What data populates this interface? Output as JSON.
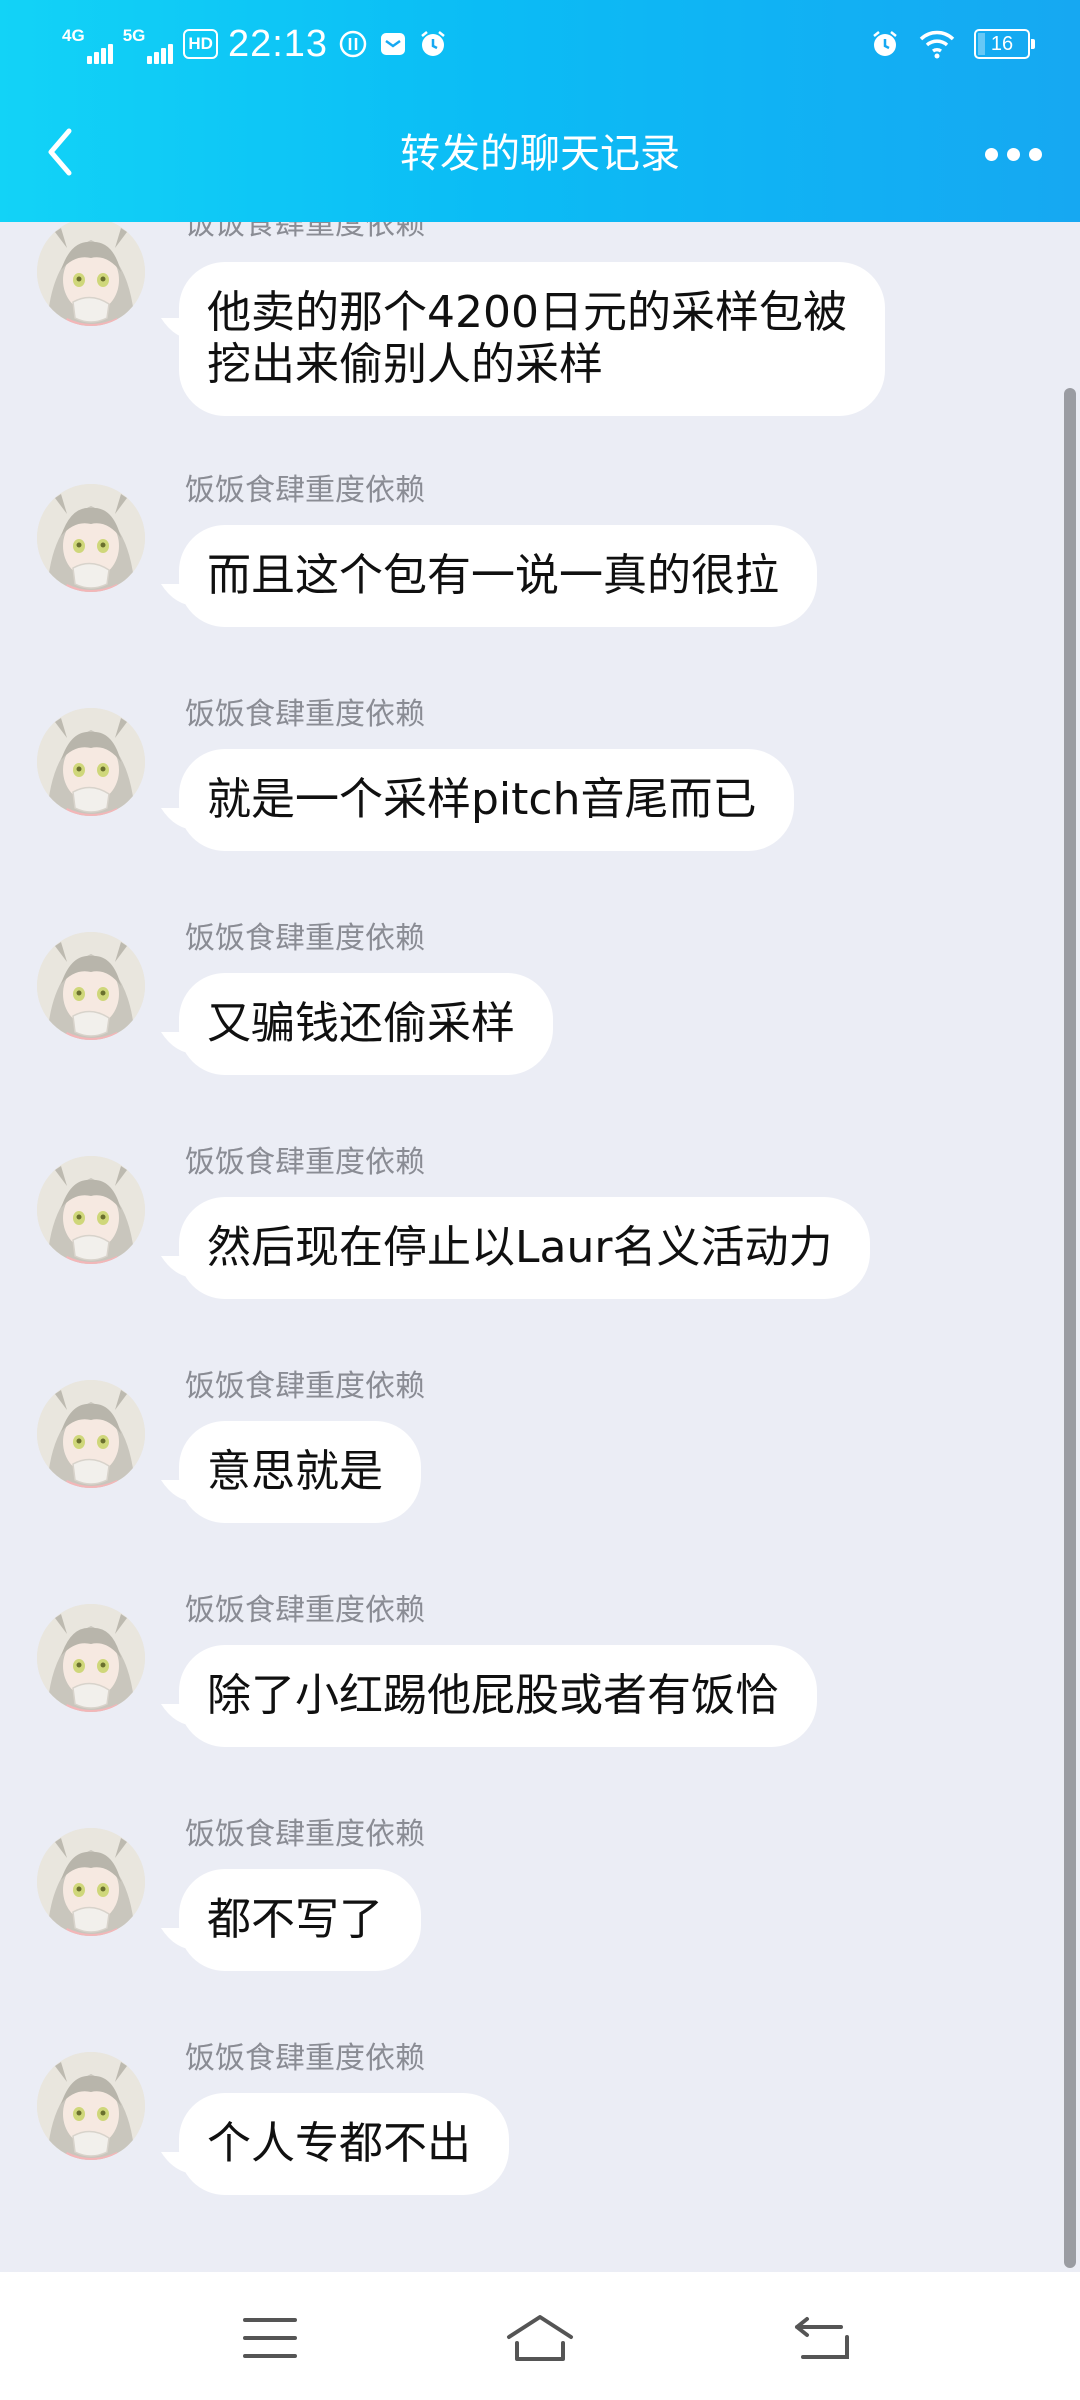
{
  "status_bar": {
    "network_1": "4G",
    "network_2": "5G",
    "hd_badge": "HD",
    "time": "22:13",
    "battery": "16",
    "icons": [
      "signal-icon",
      "hd-voice-icon",
      "vpn-icon",
      "mail-icon",
      "alarm-icon",
      "wifi-icon",
      "battery-icon"
    ]
  },
  "header": {
    "title": "转发的聊天记录",
    "back_icon": "chevron-left-icon",
    "more_icon": "more-dots-icon"
  },
  "messages": [
    {
      "sender": "饭饭食肆重度依赖",
      "text_lines": [
        "他卖的那个4200日元的采样包被",
        "挖出来偷别人的采样"
      ]
    },
    {
      "sender": "饭饭食肆重度依赖",
      "text": "而且这个包有一说一真的很拉"
    },
    {
      "sender": "饭饭食肆重度依赖",
      "text": "就是一个采样pitch音尾而已"
    },
    {
      "sender": "饭饭食肆重度依赖",
      "text": "又骗钱还偷采样"
    },
    {
      "sender": "饭饭食肆重度依赖",
      "text": "然后现在停止以Laur名义活动力"
    },
    {
      "sender": "饭饭食肆重度依赖",
      "text": "意思就是"
    },
    {
      "sender": "饭饭食肆重度依赖",
      "text": "除了小红踢他屁股或者有饭恰"
    },
    {
      "sender": "饭饭食肆重度依赖",
      "text": "都不写了"
    },
    {
      "sender": "饭饭食肆重度依赖",
      "text": "个人专都不出"
    }
  ],
  "nav_bar": {
    "icons": [
      "menu-icon",
      "home-icon",
      "back-icon"
    ]
  },
  "colors": {
    "header_gradient_start": "#12d3f7",
    "header_gradient_end": "#16a8f2",
    "background": "#ebedf5",
    "bubble": "#ffffff",
    "sender_text": "#8a8c94"
  }
}
